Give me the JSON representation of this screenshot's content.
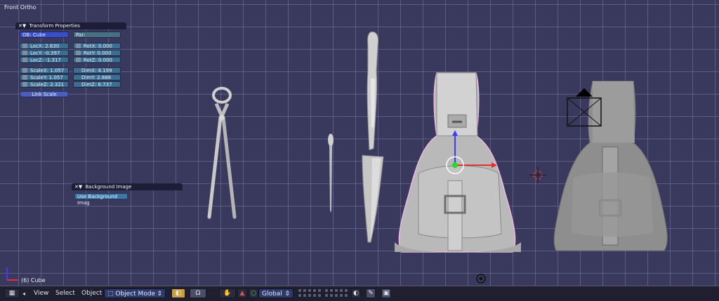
{
  "viewport": {
    "title": "Front Ortho",
    "active_object_label": "(6) Cube"
  },
  "transform_panel": {
    "title": "Transform Properties",
    "object_name": "OB: Cube",
    "parent_field": "Par:",
    "location": [
      "LocX: 2.630",
      "LocY: -0.397",
      "LocZ: -1.317"
    ],
    "rotation": [
      "RotX: 0.000",
      "RotY: 0.000",
      "RotZ: 0.000"
    ],
    "scale": [
      "ScaleX: 1.057",
      "ScaleY: 1.057",
      "ScaleZ: 2.321"
    ],
    "dimensions": [
      "DimX: 4.199",
      "DimY: 2.888",
      "DimZ: 6.737"
    ],
    "link_scale_label": "Link Scale"
  },
  "background_panel": {
    "title": "Background Image",
    "use_background_label": "Use Background Imag"
  },
  "toolbar": {
    "menus": [
      "View",
      "Select",
      "Object"
    ],
    "mode": "Object Mode",
    "orientation": "Global"
  },
  "colors": {
    "viewport_bg": "#39395e",
    "grid": "#7878aa",
    "panel_header": "#1d1d38",
    "field_blue": "#3c6d93",
    "object_field": "#3a4ec8",
    "toolbar_bg": "#1f1f30"
  }
}
